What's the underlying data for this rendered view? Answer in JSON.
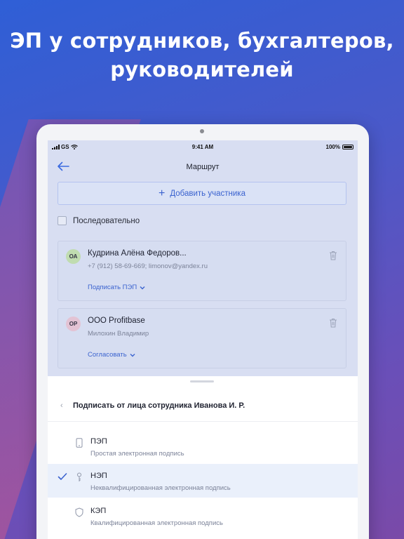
{
  "headline": {
    "line1": "ЭП у сотрудников, бухгалтеров,",
    "line2": "руководителей"
  },
  "status_bar": {
    "carrier": "GS",
    "time": "9:41 AM",
    "battery": "100%"
  },
  "nav": {
    "title": "Маршрут",
    "back_icon": "arrow-left-icon"
  },
  "add_participant": {
    "label": "Добавить участника",
    "icon": "plus-icon"
  },
  "sequential": {
    "label": "Последовательно",
    "checked": false
  },
  "participants": [
    {
      "initials": "ОА",
      "name": "Кудрина Алёна Федоров...",
      "details": "+7 (912) 58-69-669; limonov@yandex.ru",
      "action": "Подписать ПЭП",
      "avatar_color": "#c0dcb0"
    },
    {
      "initials": "ОР",
      "name": "ООО Profitbase",
      "details": "Милохин Владимир",
      "action": "Согласовать",
      "avatar_color": "#e3c3d4"
    }
  ],
  "sheet": {
    "title": "Подписать от лица сотрудника Иванова И. Р.",
    "back_glyph": "‹",
    "options": [
      {
        "title": "ПЭП",
        "subtitle": "Простая электронная подпись",
        "icon": "phone-icon",
        "selected": false
      },
      {
        "title": "НЭП",
        "subtitle": "Неквалифицированная электронная подпись",
        "icon": "key-icon",
        "selected": true
      },
      {
        "title": "КЭП",
        "subtitle": "Квалифицированная электронная подпись",
        "icon": "shield-icon",
        "selected": false
      }
    ]
  },
  "colors": {
    "accent": "#3b63cf",
    "overlay": "#d8def2",
    "selected_row": "#eaf0fb"
  }
}
